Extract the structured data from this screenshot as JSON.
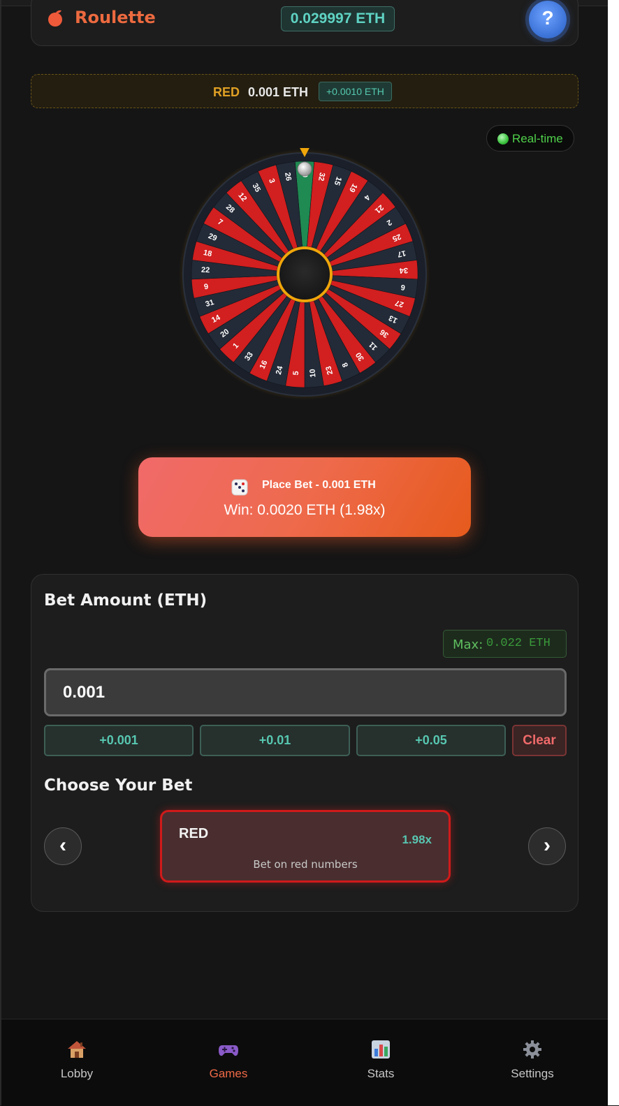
{
  "header": {
    "title": "Roulette",
    "balance": "0.029997 ETH",
    "help_label": "?"
  },
  "last_result": {
    "color": "RED",
    "amount": "0.001 ETH",
    "delta": "+0.0010 ETH"
  },
  "status": {
    "realtime_label": "Real-time"
  },
  "wheel": {
    "numbers": [
      "0",
      "32",
      "15",
      "19",
      "4",
      "21",
      "2",
      "25",
      "17",
      "34",
      "6",
      "27",
      "13",
      "36",
      "11",
      "30",
      "8",
      "23",
      "10",
      "5",
      "24",
      "16",
      "33",
      "1",
      "20",
      "14",
      "31",
      "9",
      "22",
      "18",
      "29",
      "7",
      "28",
      "12",
      "35",
      "3",
      "26"
    ],
    "colors": {
      "red": "#d21f1f",
      "black": "#232b38",
      "green": "#1f8a52",
      "hub_ring": "#f0a60a"
    }
  },
  "place_bet": {
    "label": "Place Bet - 0.001 ETH",
    "win_text": "Win: 0.0020 ETH (1.98x)"
  },
  "bet_amount": {
    "heading": "Bet Amount (ETH)",
    "max_label": "Max:",
    "max_value": "0.022 ETH",
    "value": "0.001",
    "quick_adds": [
      "+0.001",
      "+0.01",
      "+0.05"
    ],
    "clear_label": "Clear"
  },
  "choose_bet": {
    "heading": "Choose Your Bet",
    "prev_label": "‹",
    "next_label": "›",
    "option": {
      "name": "RED",
      "multiplier": "1.98x",
      "description": "Bet on red numbers"
    }
  },
  "bottom_nav": {
    "items": [
      {
        "label": "Lobby",
        "icon": "house-icon"
      },
      {
        "label": "Games",
        "icon": "gamepad-icon",
        "active": true
      },
      {
        "label": "Stats",
        "icon": "bar-chart-icon"
      },
      {
        "label": "Settings",
        "icon": "gear-icon"
      }
    ]
  }
}
